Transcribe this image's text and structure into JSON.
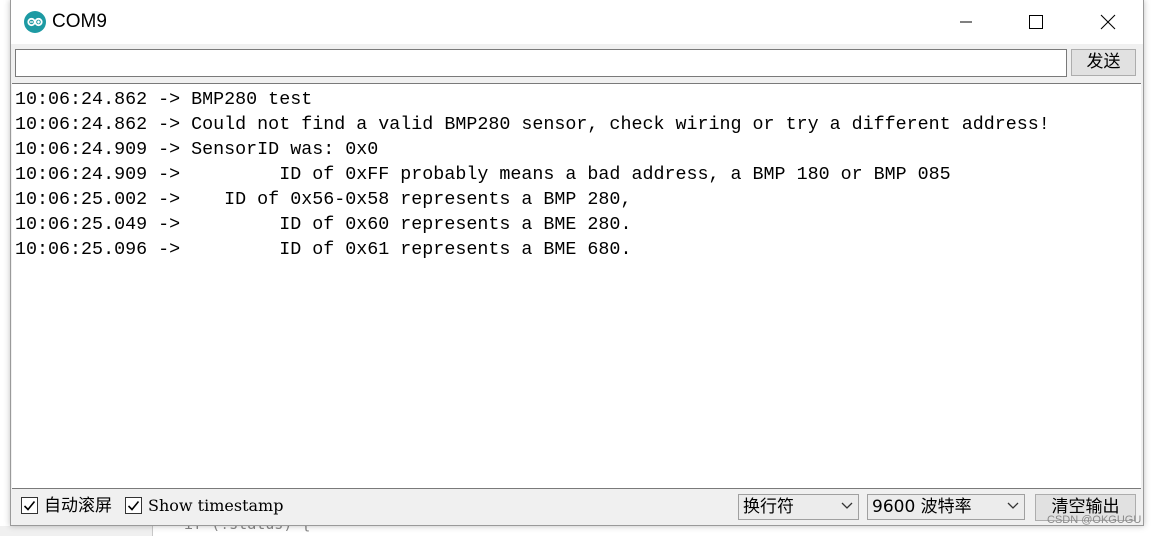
{
  "window": {
    "title": "COM9",
    "icon": "arduino-infinity-icon"
  },
  "send": {
    "input_value": "",
    "button_label": "发送"
  },
  "output": {
    "lines": [
      "10:06:24.862 -> BMP280 test",
      "10:06:24.862 -> Could not find a valid BMP280 sensor, check wiring or try a different address!",
      "10:06:24.909 -> SensorID was: 0x0",
      "10:06:24.909 ->         ID of 0xFF probably means a bad address, a BMP 180 or BMP 085",
      "10:06:25.002 ->    ID of 0x56-0x58 represents a BMP 280,",
      "10:06:25.049 ->         ID of 0x60 represents a BME 280.",
      "10:06:25.096 ->         ID of 0x61 represents a BME 680."
    ]
  },
  "status": {
    "autoscroll_label": "自动滚屏",
    "autoscroll_checked": true,
    "timestamp_label": "Show timestamp",
    "timestamp_checked": true,
    "line_ending": "换行符",
    "baud_rate": "9600 波特率",
    "clear_label": "清空输出"
  },
  "editor": {
    "partial_code": "if (!status) {"
  },
  "watermark": "CSDN @OKGUGU",
  "colors": {
    "accent": "#1d9aa3"
  }
}
